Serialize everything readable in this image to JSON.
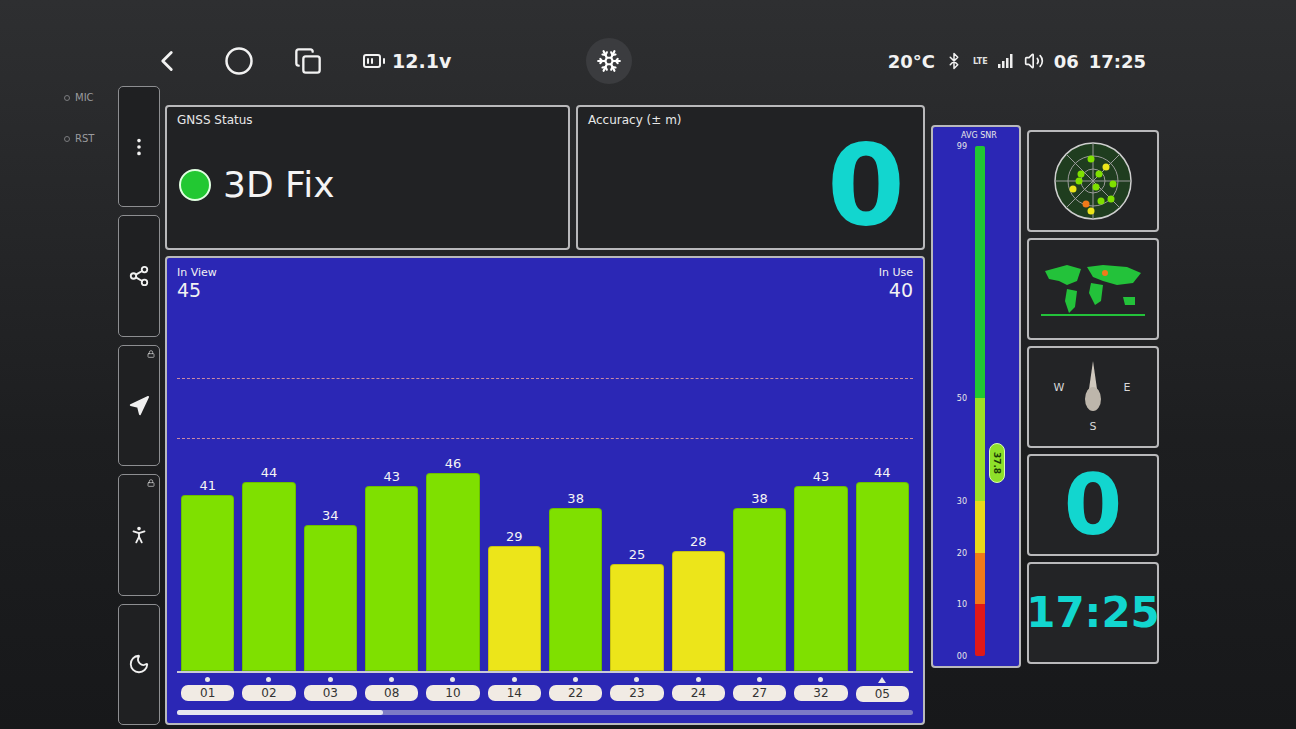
{
  "status_bar": {
    "battery_voltage": "12.1v",
    "temperature": "20°C",
    "network": "LTE",
    "volume": "06",
    "time": "17:25"
  },
  "bezel_labels": [
    "MIC",
    "RST"
  ],
  "rail": [
    {
      "locked": false
    },
    {
      "locked": false
    },
    {
      "locked": true
    },
    {
      "locked": true
    },
    {
      "locked": false
    }
  ],
  "gnss_status": {
    "label": "GNSS Status",
    "value": "3D Fix",
    "color": "#22c832"
  },
  "accuracy": {
    "label": "Accuracy (± m)",
    "value": "0"
  },
  "chart": {
    "in_view_label": "In View",
    "in_view": "45",
    "in_use_label": "In Use",
    "in_use": "40",
    "scroll_level": 0.28,
    "satellites": [
      {
        "id": "01",
        "snr": 41,
        "label": "41",
        "color": "#7fe000",
        "kind": "dot"
      },
      {
        "id": "02",
        "snr": 44,
        "label": "44",
        "color": "#7fe000",
        "kind": "dot"
      },
      {
        "id": "03",
        "snr": 34,
        "label": "34",
        "color": "#7fe000",
        "kind": "dot"
      },
      {
        "id": "08",
        "snr": 43,
        "label": "43",
        "color": "#7fe000",
        "kind": "dot"
      },
      {
        "id": "10",
        "snr": 46,
        "label": "46",
        "color": "#7fe000",
        "kind": "dot"
      },
      {
        "id": "14",
        "snr": 29,
        "label": "29",
        "color": "#ece51a",
        "kind": "dot"
      },
      {
        "id": "22",
        "snr": 38,
        "label": "38",
        "color": "#7fe000",
        "kind": "dot"
      },
      {
        "id": "23",
        "snr": 25,
        "label": "25",
        "color": "#ece51a",
        "kind": "dot"
      },
      {
        "id": "24",
        "snr": 28,
        "label": "28",
        "color": "#ece51a",
        "kind": "dot"
      },
      {
        "id": "27",
        "snr": 38,
        "label": "38",
        "color": "#7fe000",
        "kind": "dot"
      },
      {
        "id": "32",
        "snr": 43,
        "label": "43",
        "color": "#7fe000",
        "kind": "dot"
      },
      {
        "id": "05",
        "snr": 44,
        "label": "44",
        "color": "#7fe000",
        "kind": "triangle"
      }
    ]
  },
  "snr_meter": {
    "label": "AVG SNR",
    "ticks": [
      "99",
      "50",
      "30",
      "20",
      "10",
      "00"
    ],
    "reading": "37.8",
    "level": 0.378
  },
  "side_widgets": {
    "compass": [
      "W",
      "E",
      "S"
    ],
    "speed": "0",
    "clock": "17:25"
  }
}
